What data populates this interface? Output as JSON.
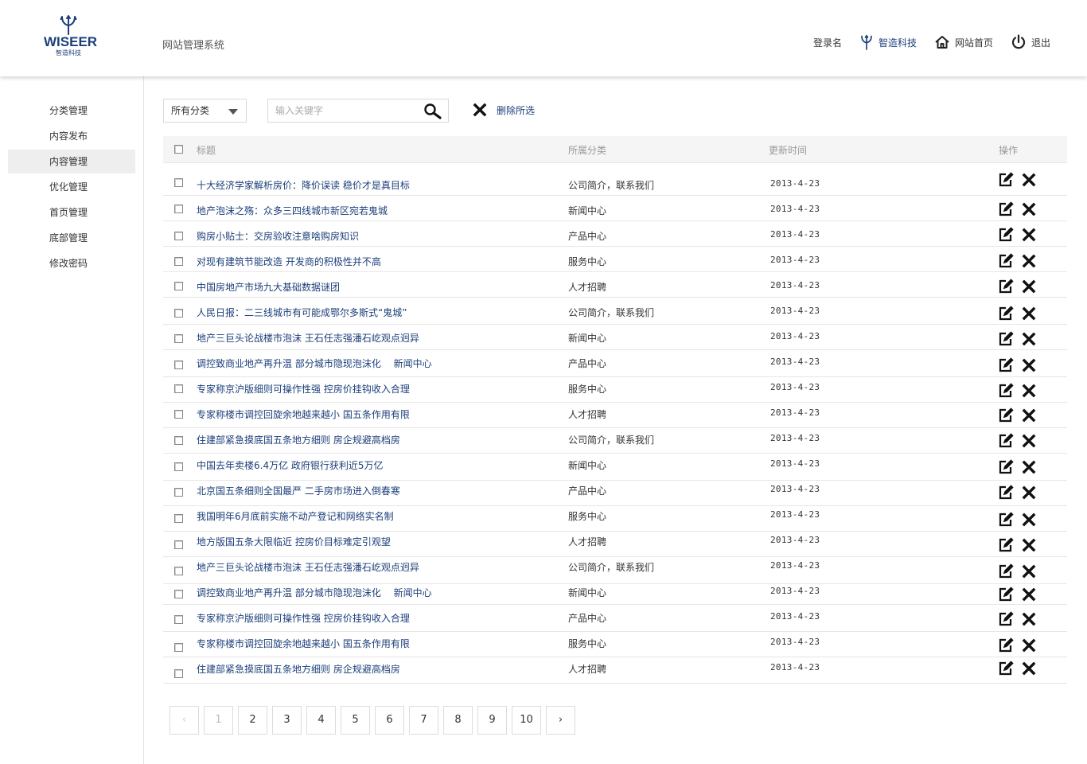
{
  "header": {
    "logo_text": "WISEER",
    "logo_sub": "智造科技",
    "system_title": "网站管理系统",
    "login_name": "登录名",
    "brand_link": "智造科技",
    "home_link": "网站首页",
    "logout_link": "退出"
  },
  "sidebar": {
    "items": [
      {
        "label": "分类管理"
      },
      {
        "label": "内容发布"
      },
      {
        "label": "内容管理"
      },
      {
        "label": "优化管理"
      },
      {
        "label": "首页管理"
      },
      {
        "label": "底部管理"
      },
      {
        "label": "修改密码"
      }
    ],
    "active_index": 2
  },
  "toolbar": {
    "category_select": "所有分类",
    "search_placeholder": "输入关键字",
    "delete_selected": "删除所选"
  },
  "table": {
    "headers": {
      "title": "标题",
      "category": "所属分类",
      "time": "更新时间",
      "action": "操作"
    },
    "rows": [
      {
        "title": "十大经济学家解析房价：降价误读 稳价才是真目标",
        "category": "公司简介，联系我们",
        "date": "2013-4-23"
      },
      {
        "title": "地产泡沫之殇：众多三四线城市新区宛若鬼城",
        "category": "新闻中心",
        "date": "2013-4-23"
      },
      {
        "title": "购房小贴士：交房验收注意啥购房知识",
        "category": "产品中心",
        "date": "2013-4-23"
      },
      {
        "title": "对现有建筑节能改造 开发商的积极性并不高",
        "category": "服务中心",
        "date": "2013-4-23"
      },
      {
        "title": "中国房地产市场九大基础数据谜团",
        "category": "人才招聘",
        "date": "2013-4-23"
      },
      {
        "title": "人民日报：二三线城市有可能成鄂尔多斯式“鬼城”",
        "category": "公司简介，联系我们",
        "date": "2013-4-23"
      },
      {
        "title": "地产三巨头论战楼市泡沫 王石任志强潘石屹观点迥异",
        "category": "新闻中心",
        "date": "2013-4-23"
      },
      {
        "title": "调控致商业地产再升温 部分城市隐现泡沫化　 新闻中心",
        "category": "产品中心",
        "date": "2013-4-23"
      },
      {
        "title": "专家称京沪版细则可操作性强 控房价挂钩收入合理",
        "category": "服务中心",
        "date": "2013-4-23"
      },
      {
        "title": "专家称楼市调控回旋余地越来越小 国五条作用有限",
        "category": "人才招聘",
        "date": "2013-4-23"
      },
      {
        "title": "住建部紧急摸底国五条地方细则 房企规避高档房",
        "category": "公司简介，联系我们",
        "date": "2013-4-23"
      },
      {
        "title": "中国去年卖楼6.4万亿 政府银行获利近5万亿",
        "category": "新闻中心",
        "date": "2013-4-23"
      },
      {
        "title": "北京国五条细则全国最严 二手房市场进入倒春寒",
        "category": "产品中心",
        "date": "2013-4-23"
      },
      {
        "title": "我国明年6月底前实施不动产登记和网络实名制",
        "category": "服务中心",
        "date": "2013-4-23"
      },
      {
        "title": "地方版国五条大限临近 控房价目标难定引观望",
        "category": "人才招聘",
        "date": "2013-4-23"
      },
      {
        "title": "地产三巨头论战楼市泡沫 王石任志强潘石屹观点迥异",
        "category": "公司简介，联系我们",
        "date": "2013-4-23"
      },
      {
        "title": "调控致商业地产再升温 部分城市隐现泡沫化　 新闻中心",
        "category": "新闻中心",
        "date": "2013-4-23"
      },
      {
        "title": "专家称京沪版细则可操作性强 控房价挂钩收入合理",
        "category": "产品中心",
        "date": "2013-4-23"
      },
      {
        "title": "专家称楼市调控回旋余地越来越小 国五条作用有限",
        "category": "服务中心",
        "date": "2013-4-23"
      },
      {
        "title": "住建部紧急摸底国五条地方细则 房企规避高档房",
        "category": "人才招聘",
        "date": "2013-4-23"
      }
    ]
  },
  "pagination": {
    "pages": [
      "1",
      "2",
      "3",
      "4",
      "5",
      "6",
      "7",
      "8",
      "9",
      "10"
    ],
    "current": "1",
    "prev": "‹",
    "next": "›"
  },
  "colors": {
    "brand": "#1c3f7a",
    "active_sidebar_bg": "#eeeeee",
    "header_row_bg": "#f5f5f5"
  },
  "icons": {
    "search": "search-icon",
    "delete": "close-icon",
    "edit": "edit-icon",
    "home": "home-icon",
    "power": "power-icon",
    "trident": "trident-icon"
  }
}
